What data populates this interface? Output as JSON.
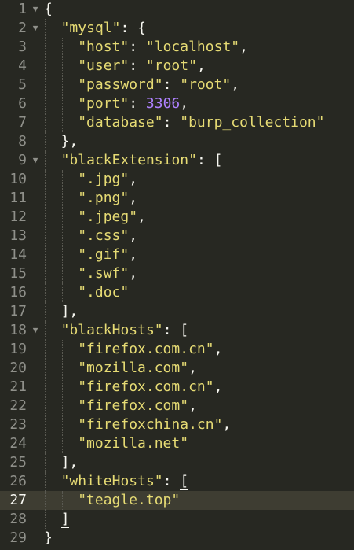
{
  "editor": {
    "fold_icon": "triangle-down",
    "colors": {
      "background": "#272822",
      "active_line": "#3e3d32",
      "string": "#e6db74",
      "number": "#ae81ff",
      "text": "#f8f8f2",
      "gutter": "#8f908a"
    },
    "active_line": 27,
    "lines": [
      {
        "n": "1",
        "fold": true,
        "indent": 0,
        "tokens": [
          [
            "punc",
            "{"
          ]
        ]
      },
      {
        "n": "2",
        "fold": true,
        "indent": 1,
        "tokens": [
          [
            "str",
            "\"mysql\""
          ],
          [
            "punc",
            ": {"
          ]
        ]
      },
      {
        "n": "3",
        "fold": false,
        "indent": 2,
        "tokens": [
          [
            "str",
            "\"host\""
          ],
          [
            "punc",
            ": "
          ],
          [
            "str",
            "\"localhost\""
          ],
          [
            "punc",
            ","
          ]
        ]
      },
      {
        "n": "4",
        "fold": false,
        "indent": 2,
        "tokens": [
          [
            "str",
            "\"user\""
          ],
          [
            "punc",
            ": "
          ],
          [
            "str",
            "\"root\""
          ],
          [
            "punc",
            ","
          ]
        ]
      },
      {
        "n": "5",
        "fold": false,
        "indent": 2,
        "tokens": [
          [
            "str",
            "\"password\""
          ],
          [
            "punc",
            ": "
          ],
          [
            "str",
            "\"root\""
          ],
          [
            "punc",
            ","
          ]
        ]
      },
      {
        "n": "6",
        "fold": false,
        "indent": 2,
        "tokens": [
          [
            "str",
            "\"port\""
          ],
          [
            "punc",
            ": "
          ],
          [
            "num",
            "3306"
          ],
          [
            "punc",
            ","
          ]
        ]
      },
      {
        "n": "7",
        "fold": false,
        "indent": 2,
        "tokens": [
          [
            "str",
            "\"database\""
          ],
          [
            "punc",
            ": "
          ],
          [
            "str",
            "\"burp_collection\""
          ]
        ]
      },
      {
        "n": "8",
        "fold": false,
        "indent": 1,
        "tokens": [
          [
            "punc",
            "},"
          ]
        ]
      },
      {
        "n": "9",
        "fold": true,
        "indent": 1,
        "tokens": [
          [
            "str",
            "\"blackExtension\""
          ],
          [
            "punc",
            ": ["
          ]
        ]
      },
      {
        "n": "10",
        "fold": false,
        "indent": 2,
        "tokens": [
          [
            "str",
            "\".jpg\""
          ],
          [
            "punc",
            ","
          ]
        ]
      },
      {
        "n": "11",
        "fold": false,
        "indent": 2,
        "tokens": [
          [
            "str",
            "\".png\""
          ],
          [
            "punc",
            ","
          ]
        ]
      },
      {
        "n": "12",
        "fold": false,
        "indent": 2,
        "tokens": [
          [
            "str",
            "\".jpeg\""
          ],
          [
            "punc",
            ","
          ]
        ]
      },
      {
        "n": "13",
        "fold": false,
        "indent": 2,
        "tokens": [
          [
            "str",
            "\".css\""
          ],
          [
            "punc",
            ","
          ]
        ]
      },
      {
        "n": "14",
        "fold": false,
        "indent": 2,
        "tokens": [
          [
            "str",
            "\".gif\""
          ],
          [
            "punc",
            ","
          ]
        ]
      },
      {
        "n": "15",
        "fold": false,
        "indent": 2,
        "tokens": [
          [
            "str",
            "\".swf\""
          ],
          [
            "punc",
            ","
          ]
        ]
      },
      {
        "n": "16",
        "fold": false,
        "indent": 2,
        "tokens": [
          [
            "str",
            "\".doc\""
          ]
        ]
      },
      {
        "n": "17",
        "fold": false,
        "indent": 1,
        "tokens": [
          [
            "punc",
            "],"
          ]
        ]
      },
      {
        "n": "18",
        "fold": true,
        "indent": 1,
        "tokens": [
          [
            "str",
            "\"blackHosts\""
          ],
          [
            "punc",
            ": ["
          ]
        ]
      },
      {
        "n": "19",
        "fold": false,
        "indent": 2,
        "tokens": [
          [
            "str",
            "\"firefox.com.cn\""
          ],
          [
            "punc",
            ","
          ]
        ]
      },
      {
        "n": "20",
        "fold": false,
        "indent": 2,
        "tokens": [
          [
            "str",
            "\"mozilla.com\""
          ],
          [
            "punc",
            ","
          ]
        ]
      },
      {
        "n": "21",
        "fold": false,
        "indent": 2,
        "tokens": [
          [
            "str",
            "\"firefox.com.cn\""
          ],
          [
            "punc",
            ","
          ]
        ]
      },
      {
        "n": "22",
        "fold": false,
        "indent": 2,
        "tokens": [
          [
            "str",
            "\"firefox.com\""
          ],
          [
            "punc",
            ","
          ]
        ]
      },
      {
        "n": "23",
        "fold": false,
        "indent": 2,
        "tokens": [
          [
            "str",
            "\"firefoxchina.cn\""
          ],
          [
            "punc",
            ","
          ]
        ]
      },
      {
        "n": "24",
        "fold": false,
        "indent": 2,
        "tokens": [
          [
            "str",
            "\"mozilla.net\""
          ]
        ]
      },
      {
        "n": "25",
        "fold": false,
        "indent": 1,
        "tokens": [
          [
            "punc",
            "],"
          ]
        ]
      },
      {
        "n": "26",
        "fold": false,
        "indent": 1,
        "tokens": [
          [
            "str",
            "\"whiteHosts\""
          ],
          [
            "punc",
            ": "
          ],
          [
            "bracket",
            "["
          ]
        ]
      },
      {
        "n": "27",
        "fold": false,
        "indent": 2,
        "tokens": [
          [
            "str",
            "\"teagle.top\""
          ]
        ]
      },
      {
        "n": "28",
        "fold": false,
        "indent": 1,
        "tokens": [
          [
            "bracket",
            "]"
          ]
        ]
      },
      {
        "n": "29",
        "fold": false,
        "indent": 0,
        "tokens": [
          [
            "punc",
            "}"
          ]
        ]
      }
    ]
  }
}
